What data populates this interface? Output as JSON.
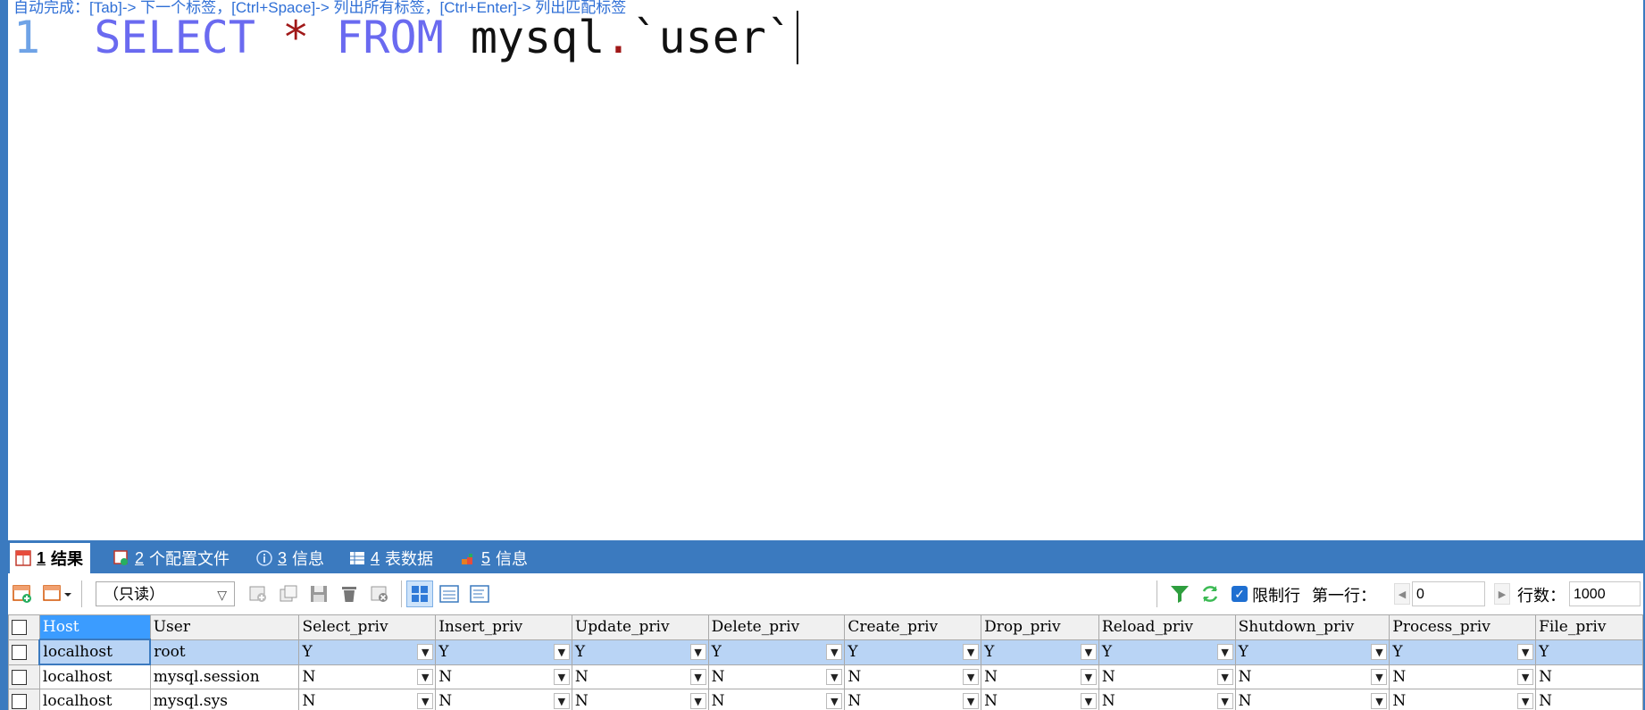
{
  "editor": {
    "hint": "自动完成：[Tab]-> 下一个标签，[Ctrl+Space]-> 列出所有标签，[Ctrl+Enter]-> 列出匹配标签",
    "line_number": "1",
    "kw_select": "SELECT",
    "star": "*",
    "kw_from": "FROM",
    "schema": "mysql",
    "dot": ".",
    "table": "`user`"
  },
  "tabs": [
    {
      "num": "1",
      "label": "结果",
      "icon": "result-grid-icon"
    },
    {
      "num": "2",
      "label": "个配置文件",
      "icon": "profile-icon"
    },
    {
      "num": "3",
      "label": "信息",
      "icon": "info-icon"
    },
    {
      "num": "4",
      "label": "表数据",
      "icon": "table-data-icon"
    },
    {
      "num": "5",
      "label": "信息",
      "icon": "info-history-icon"
    }
  ],
  "toolbar": {
    "mode": "（只读）",
    "limit_label": "限制行",
    "first_row_label": "第一行：",
    "first_row_value": "0",
    "rows_label": "行数：",
    "rows_value": "1000"
  },
  "grid": {
    "columns": [
      "Host",
      "User",
      "Select_priv",
      "Insert_priv",
      "Update_priv",
      "Delete_priv",
      "Create_priv",
      "Drop_priv",
      "Reload_priv",
      "Shutdown_priv",
      "Process_priv",
      "File_priv"
    ],
    "rows": [
      [
        "localhost",
        "root",
        "Y",
        "Y",
        "Y",
        "Y",
        "Y",
        "Y",
        "Y",
        "Y",
        "Y",
        "Y"
      ],
      [
        "localhost",
        "mysql.session",
        "N",
        "N",
        "N",
        "N",
        "N",
        "N",
        "N",
        "N",
        "N",
        "N"
      ],
      [
        "localhost",
        "mysql.sys",
        "N",
        "N",
        "N",
        "N",
        "N",
        "N",
        "N",
        "N",
        "N",
        "N"
      ]
    ]
  },
  "colors": {
    "accent": "#3b7abf",
    "keyword": "#6a6af0",
    "operator": "#a01818",
    "selected_row": "#b9d4f5"
  }
}
